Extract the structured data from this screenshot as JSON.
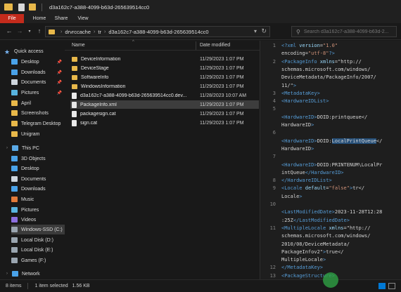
{
  "window": {
    "title": "d3a162c7-a388-4099-b63d-265639514cc0"
  },
  "ribbon": {
    "tabs": [
      "File",
      "Home",
      "Share",
      "View"
    ]
  },
  "address": {
    "crumbs": [
      "drvrccache",
      "tr",
      "d3a162c7-a388-4099-b63d-265639514cc0"
    ],
    "search_placeholder": "Search d3a162c7-a388-4099-b63d-2..."
  },
  "sidebar": {
    "items": [
      {
        "label": "Quick access",
        "icon": "star-icon"
      },
      {
        "label": "Desktop",
        "icon": "desktop-icon"
      },
      {
        "label": "Downloads",
        "icon": "download-icon"
      },
      {
        "label": "Documents",
        "icon": "documents-icon"
      },
      {
        "label": "Pictures",
        "icon": "pictures-icon"
      },
      {
        "label": "April",
        "icon": "folder-icon"
      },
      {
        "label": "Screenshots",
        "icon": "folder-icon"
      },
      {
        "label": "Telegram Desktop",
        "icon": "folder-icon"
      },
      {
        "label": "Unigram",
        "icon": "folder-icon"
      },
      {
        "label": "This PC",
        "icon": "pc-icon"
      },
      {
        "label": "3D Objects",
        "icon": "3d-objects-icon"
      },
      {
        "label": "Desktop",
        "icon": "desktop-icon"
      },
      {
        "label": "Documents",
        "icon": "documents-icon"
      },
      {
        "label": "Downloads",
        "icon": "download-icon"
      },
      {
        "label": "Music",
        "icon": "music-icon"
      },
      {
        "label": "Pictures",
        "icon": "pictures-icon"
      },
      {
        "label": "Videos",
        "icon": "videos-icon"
      },
      {
        "label": "Windows-SSD (C:)",
        "icon": "drive-icon"
      },
      {
        "label": "Local Disk (D:)",
        "icon": "drive-icon"
      },
      {
        "label": "Local Disk (E:)",
        "icon": "drive-icon"
      },
      {
        "label": "Games (F:)",
        "icon": "drive-icon"
      },
      {
        "label": "Network",
        "icon": "network-icon"
      }
    ]
  },
  "filelist": {
    "columns": {
      "name": "Name",
      "date": "Date modified"
    },
    "rows": [
      {
        "name": "DeviceInformation",
        "date": "11/29/2023 1:07 PM",
        "type": "folder"
      },
      {
        "name": "DeviceStage",
        "date": "11/29/2023 1:07 PM",
        "type": "folder"
      },
      {
        "name": "SoftwareInfo",
        "date": "11/29/2023 1:07 PM",
        "type": "folder"
      },
      {
        "name": "WindowsInformation",
        "date": "11/29/2023 1:07 PM",
        "type": "folder"
      },
      {
        "name": "d3a162c7-a388-4099-b63d-265639514cc0.dev...",
        "date": "11/28/2023 10:07 AM",
        "type": "file"
      },
      {
        "name": "PackageInfo.xml",
        "date": "11/29/2023 1:07 PM",
        "type": "file"
      },
      {
        "name": "packagesign.cat",
        "date": "11/29/2023 1:07 PM",
        "type": "file"
      },
      {
        "name": "sign.cat",
        "date": "11/29/2023 1:07 PM",
        "type": "file"
      }
    ]
  },
  "preview": {
    "lines": [
      {
        "num": "1",
        "text": "<?xml version=\"1.0\""
      },
      {
        "num": "",
        "text": "encoding=\"utf-8\"?>"
      },
      {
        "num": "2",
        "text": "<PackageInfo xmlns=\"http://"
      },
      {
        "num": "",
        "text": "schemas.microsoft.com/windows/"
      },
      {
        "num": "",
        "text": "DeviceMetadata/PackageInfo/2007/"
      },
      {
        "num": "",
        "text": "11/\">"
      },
      {
        "num": "3",
        "text": "  <MetadataKey>"
      },
      {
        "num": "4",
        "text": "    <HardwareIDList>"
      },
      {
        "num": "5",
        "text": ""
      },
      {
        "num": "",
        "text": "<HardwareID>DOID:printqueue</"
      },
      {
        "num": "",
        "text": "HardwareID>"
      },
      {
        "num": "6",
        "text": ""
      },
      {
        "num": "",
        "text": "<HardwareID>DOID:LocalPrintQueue</"
      },
      {
        "num": "",
        "text": "HardwareID>"
      },
      {
        "num": "7",
        "text": ""
      },
      {
        "num": "",
        "text": "<HardwareID>DOID:PRINTENUM\\LocalPr"
      },
      {
        "num": "",
        "text": "intQueue</HardwareID>"
      },
      {
        "num": "8",
        "text": "    </HardwareIDList>"
      },
      {
        "num": "9",
        "text": "    <Locale default=\"false\">tr</"
      },
      {
        "num": "",
        "text": "Locale>"
      },
      {
        "num": "10",
        "text": ""
      },
      {
        "num": "",
        "text": "<LastModifiedDate>2023-11-28T12:28"
      },
      {
        "num": "",
        "text": ":25Z</LastModifiedDate>"
      },
      {
        "num": "11",
        "text": "    <MultipleLocale xmlns=\"http://"
      },
      {
        "num": "",
        "text": "schemas.microsoft.com/windows/"
      },
      {
        "num": "",
        "text": "2010/08/DeviceMetadata/"
      },
      {
        "num": "",
        "text": "PackageInfov2\">true</"
      },
      {
        "num": "",
        "text": "MultipleLocale>"
      },
      {
        "num": "12",
        "text": "  </MetadataKey>"
      },
      {
        "num": "13",
        "text": "  <PackageStructure>"
      }
    ]
  },
  "status": {
    "count": "8 items",
    "selection": "1 item selected",
    "size": "1.56 KB"
  },
  "colors": {
    "file_tab": "#c42b1c",
    "accent": "#0078d4",
    "folder": "#e8b84a",
    "xml_tag": "#569cd6",
    "xml_attr": "#9cdcfe",
    "xml_string": "#ce9178"
  }
}
